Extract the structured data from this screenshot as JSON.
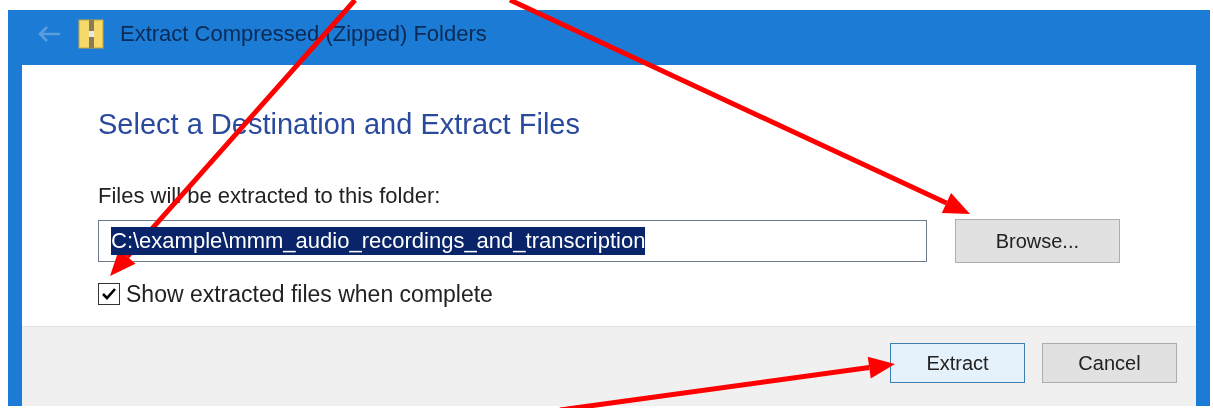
{
  "window": {
    "title": "Extract Compressed (Zipped) Folders",
    "back_disabled": true
  },
  "heading": "Select a Destination and Extract Files",
  "folder_label": "Files will be extracted to this folder:",
  "path_field": {
    "value": "C:\\example\\mmm_audio_recordings_and_transcription",
    "text_selected": true
  },
  "browse_button": "Browse...",
  "show_files": {
    "label": "Show extracted files when complete",
    "checked": true
  },
  "buttons": [
    {
      "label": "Extract",
      "default": true
    },
    {
      "label": "Cancel",
      "default": false
    }
  ]
}
